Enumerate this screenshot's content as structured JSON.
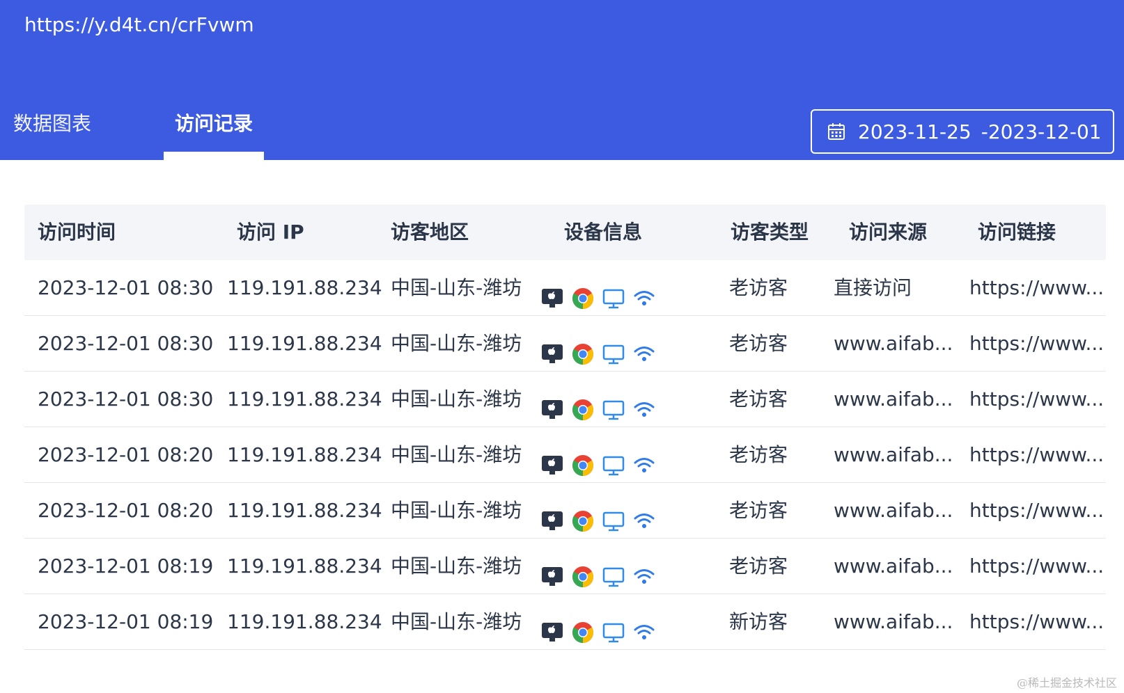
{
  "header": {
    "url": "https://y.d4t.cn/crFvwm",
    "tabs": [
      {
        "label": "数据图表",
        "active": false
      },
      {
        "label": "访问记录",
        "active": true
      }
    ],
    "date_range": {
      "icon": "calendar-icon",
      "start": "2023-11-25",
      "separator": "-",
      "end": "2023-12-01"
    },
    "colors": {
      "accent": "#3d5be0"
    }
  },
  "table": {
    "columns": [
      "访问时间",
      "访问 IP",
      "访客地区",
      "设备信息",
      "访客类型",
      "访问来源",
      "访问链接"
    ],
    "device_icons": [
      "apple-os-icon",
      "chrome-browser-icon",
      "desktop-icon",
      "wifi-icon"
    ],
    "rows": [
      {
        "time": "2023-12-01 08:30",
        "ip": "119.191.88.234",
        "region": "中国-山东-潍坊",
        "type": "老访客",
        "source": "直接访问",
        "link": "https://www..."
      },
      {
        "time": "2023-12-01 08:30",
        "ip": "119.191.88.234",
        "region": "中国-山东-潍坊",
        "type": "老访客",
        "source": "www.aifab...",
        "link": "https://www..."
      },
      {
        "time": "2023-12-01 08:30",
        "ip": "119.191.88.234",
        "region": "中国-山东-潍坊",
        "type": "老访客",
        "source": "www.aifab...",
        "link": "https://www..."
      },
      {
        "time": "2023-12-01 08:20",
        "ip": "119.191.88.234",
        "region": "中国-山东-潍坊",
        "type": "老访客",
        "source": "www.aifab...",
        "link": "https://www..."
      },
      {
        "time": "2023-12-01 08:20",
        "ip": "119.191.88.234",
        "region": "中国-山东-潍坊",
        "type": "老访客",
        "source": "www.aifab...",
        "link": "https://www..."
      },
      {
        "time": "2023-12-01 08:19",
        "ip": "119.191.88.234",
        "region": "中国-山东-潍坊",
        "type": "老访客",
        "source": "www.aifab...",
        "link": "https://www..."
      },
      {
        "time": "2023-12-01 08:19",
        "ip": "119.191.88.234",
        "region": "中国-山东-潍坊",
        "type": "新访客",
        "source": "www.aifab...",
        "link": "https://www..."
      }
    ]
  },
  "watermark": "@稀土掘金技术社区"
}
